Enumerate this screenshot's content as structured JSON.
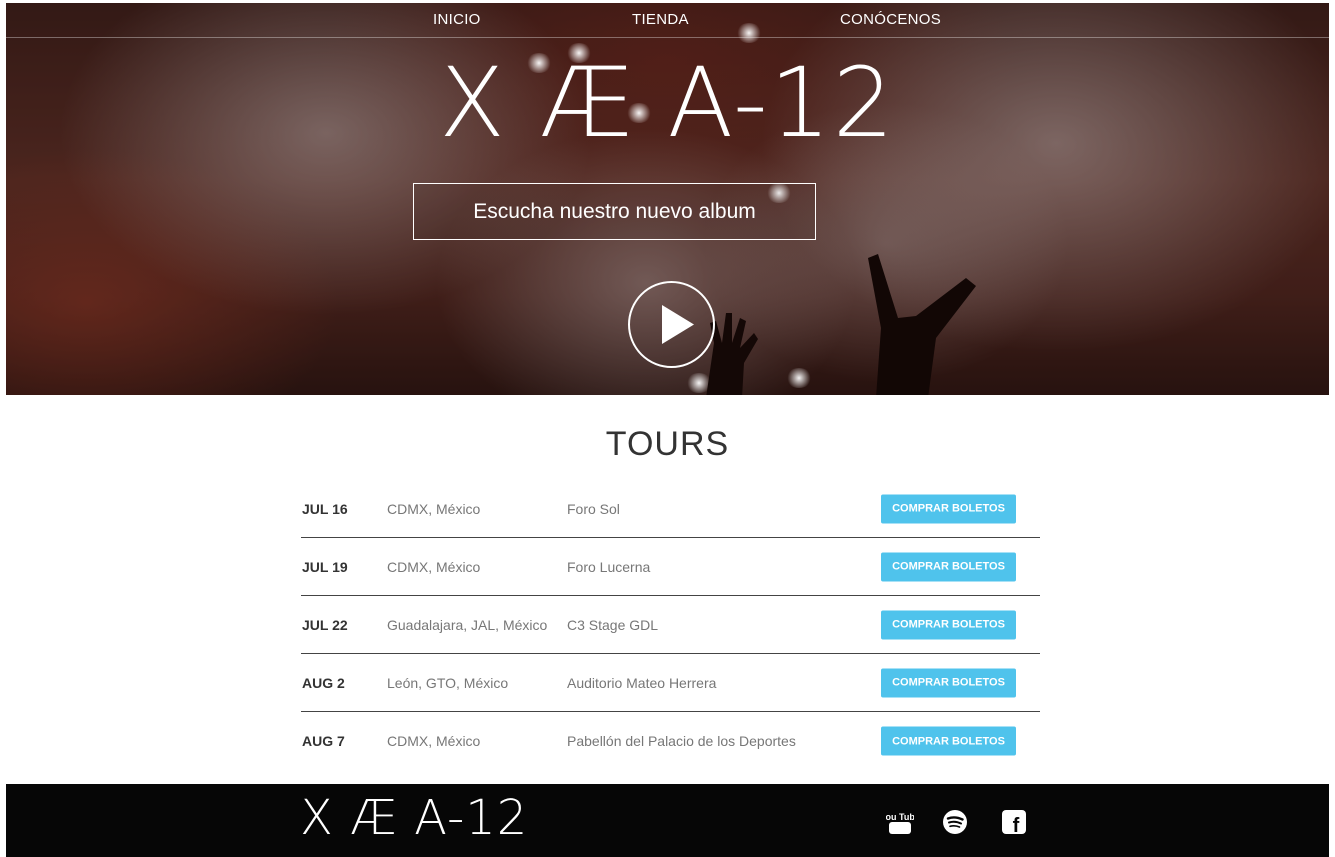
{
  "nav": {
    "items": [
      {
        "label": "INICIO"
      },
      {
        "label": "TIENDA"
      },
      {
        "label": "CONÓCENOS"
      }
    ]
  },
  "hero": {
    "title": "X Æ A-12",
    "album_button": "Escucha nuestro nuevo album",
    "play_icon": "play-icon"
  },
  "tours": {
    "title": "TOURS",
    "button_label": "COMPRAR BOLETOS",
    "button_color": "#4fc3ec",
    "rows": [
      {
        "date": "JUL 16",
        "city": "CDMX, México",
        "venue": "Foro Sol"
      },
      {
        "date": "JUL 19",
        "city": "CDMX, México",
        "venue": "Foro Lucerna"
      },
      {
        "date": "JUL 22",
        "city": "Guadalajara, JAL, México",
        "venue": "C3 Stage GDL"
      },
      {
        "date": "AUG 2",
        "city": "León, GTO, México",
        "venue": "Auditorio Mateo Herrera"
      },
      {
        "date": "AUG 7",
        "city": "CDMX, México",
        "venue": "Pabellón del Palacio de los Deportes"
      }
    ]
  },
  "footer": {
    "logo": "X Æ A-12",
    "social": [
      {
        "icon": "youtube-icon",
        "text": "You Tube"
      },
      {
        "icon": "spotify-icon"
      },
      {
        "icon": "facebook-icon",
        "text": "f"
      }
    ],
    "background": "#060606"
  }
}
